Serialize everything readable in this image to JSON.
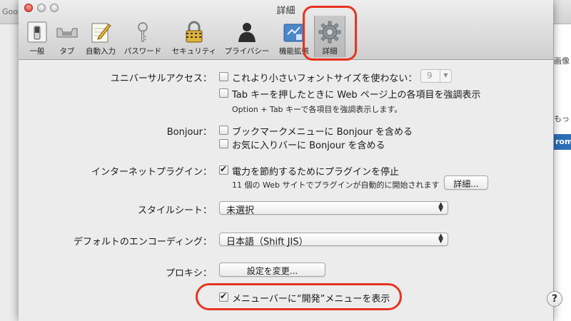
{
  "background": {
    "tab_text": "Goo",
    "right_texts": [
      "画像",
      "もっ",
      "rom"
    ]
  },
  "window": {
    "title": "詳細"
  },
  "toolbar": {
    "items": [
      {
        "label": "一般",
        "icon": "general-switch-icon"
      },
      {
        "label": "タブ",
        "icon": "tabs-icon"
      },
      {
        "label": "自動入力",
        "icon": "autofill-pencil-icon"
      },
      {
        "label": "パスワード",
        "icon": "passwords-key-icon"
      },
      {
        "label": "セキュリティ",
        "icon": "security-padlock-icon"
      },
      {
        "label": "プライバシー",
        "icon": "privacy-silhouette-icon"
      },
      {
        "label": "機能拡張",
        "icon": "extensions-puzzle-icon"
      },
      {
        "label": "詳細",
        "icon": "advanced-gear-icon",
        "active": true
      }
    ]
  },
  "universal_access": {
    "label": "ユニバーサルアクセス：",
    "min_font": {
      "text": "これより小さいフォントサイズを使わない：",
      "checked": false,
      "value": "9"
    },
    "tab_highlight": {
      "text": "Tab キーを押したときに Web ページ上の各項目を強調表示",
      "checked": false
    },
    "note": "Option + Tab キーで各項目を強調表示します。"
  },
  "bonjour": {
    "label": "Bonjour：",
    "bookmarks_menu": {
      "text": "ブックマークメニューに Bonjour を含める",
      "checked": false
    },
    "favorites_bar": {
      "text": "お気に入りバーに Bonjour を含める",
      "checked": false
    }
  },
  "plugins": {
    "label": "インターネットプラグイン：",
    "save_power": {
      "text": "電力を節約するためにプラグインを停止",
      "checked": true
    },
    "note": "11 個の Web サイトでプラグインが自動的に開始されます",
    "details_button": "詳細..."
  },
  "stylesheet": {
    "label": "スタイルシート：",
    "value": "未選択"
  },
  "encoding": {
    "label": "デフォルトのエンコーディング：",
    "value": "日本語（Shift JIS）"
  },
  "proxy": {
    "label": "プロキシ：",
    "button": "設定を変更..."
  },
  "develop_menu": {
    "text": "メニューバーに“開発”メニューを表示",
    "checked": true
  },
  "help": "?",
  "colors": {
    "annotation": "#e8331f",
    "window_bg": "#ececec"
  }
}
